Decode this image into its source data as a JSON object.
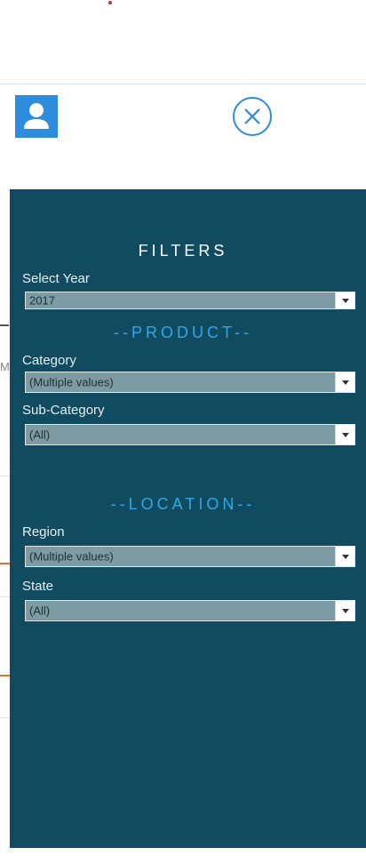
{
  "filters_panel": {
    "title": "FILTERS",
    "year": {
      "label": "Select Year",
      "value": "2017"
    },
    "product_section": "--PRODUCT--",
    "category": {
      "label": "Category",
      "value": "(Multiple values)"
    },
    "sub_category": {
      "label": "Sub-Category",
      "value": "(All)"
    },
    "location_section": "--LOCATION--",
    "region": {
      "label": "Region",
      "value": "(Multiple values)"
    },
    "state": {
      "label": "State",
      "value": "(All)"
    }
  },
  "background": {
    "partial_letter": "M"
  },
  "icons": {
    "avatar": "user-icon",
    "close": "close-circle-icon"
  },
  "colors": {
    "panel_bg": "#114b5f",
    "accent": "#2ea8e8",
    "avatar_bg": "#2d8cdc",
    "select_bg": "#7d9ba3"
  }
}
